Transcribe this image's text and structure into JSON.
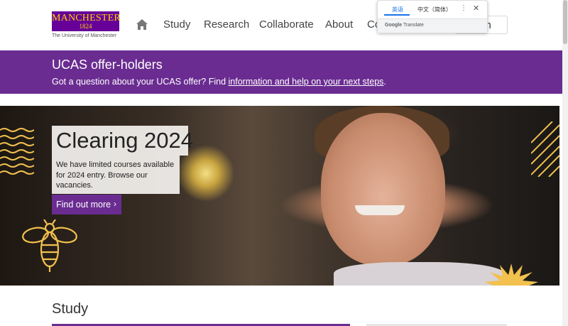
{
  "header": {
    "logo": {
      "word": "MANCHESTER",
      "year": "1824",
      "subtitle": "The University of Manchester"
    },
    "nav": [
      "Study",
      "Research",
      "Collaborate",
      "About",
      "Co"
    ],
    "search_text": "rch"
  },
  "translate_popup": {
    "tab_source": "英语",
    "tab_target": "中文（简体）",
    "menu_icon": "⋮",
    "close_icon": "✕",
    "brand": "Google",
    "product": "Translate"
  },
  "ucas": {
    "title": "UCAS offer-holders",
    "text_before": "Got a question about your UCAS offer? Find ",
    "link": "information and help on your next steps",
    "text_after": "."
  },
  "hero": {
    "title": "Clearing 2024",
    "description": "We have limited courses available for 2024 entry. Browse our vacancies.",
    "button": "Find out more",
    "button_chevron": "›"
  },
  "study": {
    "title": "Study"
  },
  "colors": {
    "purple": "#6a2c91",
    "gold": "#ffd200",
    "accent_yellow": "#f2c14e"
  }
}
